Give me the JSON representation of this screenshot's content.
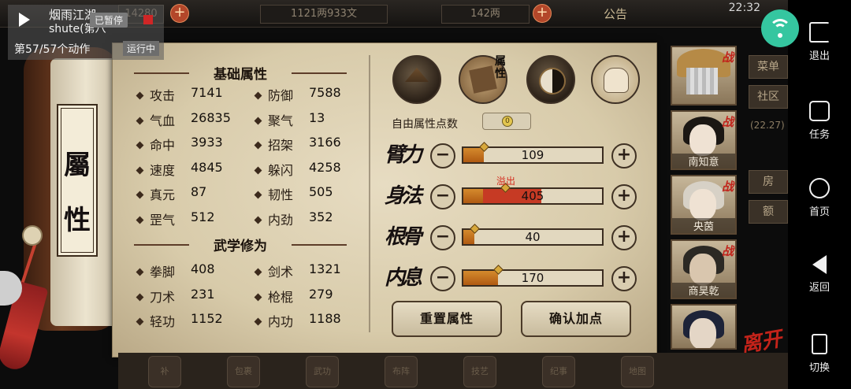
{
  "recorder": {
    "title": "烟雨江湖",
    "subtitle": "shute(第八",
    "paused": "已暂停",
    "action_count": "第57/57个动作",
    "running": "运行中"
  },
  "topbar": {
    "silver": "1121两933文",
    "gold": "142两",
    "notice": "公告",
    "time": "22:32",
    "left_value": "14280"
  },
  "scroll": {
    "chars": [
      "屬",
      "性"
    ]
  },
  "basic": {
    "title": "基础属性",
    "stats": [
      {
        "label": "攻击",
        "value": "7141"
      },
      {
        "label": "防御",
        "value": "7588"
      },
      {
        "label": "气血",
        "value": "26835"
      },
      {
        "label": "聚气",
        "value": "13"
      },
      {
        "label": "命中",
        "value": "3933"
      },
      {
        "label": "招架",
        "value": "3166"
      },
      {
        "label": "速度",
        "value": "4845"
      },
      {
        "label": "躲闪",
        "value": "4258"
      },
      {
        "label": "真元",
        "value": "87"
      },
      {
        "label": "韧性",
        "value": "505"
      },
      {
        "label": "罡气",
        "value": "512"
      },
      {
        "label": "内劲",
        "value": "352"
      }
    ]
  },
  "martial": {
    "title": "武学修为",
    "stats": [
      {
        "label": "拳脚",
        "value": "408"
      },
      {
        "label": "剑术",
        "value": "1321"
      },
      {
        "label": "刀术",
        "value": "231"
      },
      {
        "label": "枪棍",
        "value": "279"
      },
      {
        "label": "轻功",
        "value": "1152"
      },
      {
        "label": "内功",
        "value": "1188"
      }
    ]
  },
  "tabs": {
    "attr_tab_label": "属性",
    "icons": [
      "hat-figure-icon",
      "attribute-book-icon",
      "yin-yang-icon",
      "body-meridian-icon"
    ]
  },
  "free_points": {
    "label": "自由属性点数",
    "value": "0"
  },
  "attributes": [
    {
      "name": "臂力",
      "value": "109",
      "fill": 0.15,
      "overflow": false
    },
    {
      "name": "身法",
      "value": "405",
      "fill": 0.56,
      "overflow": true,
      "overflow_label": "溢出"
    },
    {
      "name": "根骨",
      "value": "40",
      "fill": 0.08,
      "overflow": false
    },
    {
      "name": "内息",
      "value": "170",
      "fill": 0.25,
      "overflow": false
    }
  ],
  "buttons": {
    "reset": "重置属性",
    "confirm": "确认加点"
  },
  "characters": [
    {
      "name": "",
      "battle": "战",
      "blurred": true
    },
    {
      "name": "南知意",
      "battle": "战"
    },
    {
      "name": "央茵",
      "battle": "战"
    },
    {
      "name": "商昊乾",
      "battle": "战"
    },
    {
      "name": "",
      "battle": ""
    }
  ],
  "leave_label": "离开",
  "side_tabs": [
    "菜单",
    "社区",
    "房",
    "额"
  ],
  "side_date": "(22.27)",
  "bottom_icons": [
    "补",
    "包裹",
    "武功",
    "布阵",
    "技艺",
    "纪事",
    "地图"
  ],
  "nav": {
    "exit": "退出",
    "task": "任务",
    "home": "首页",
    "back": "返回",
    "switch": "切换"
  },
  "colors": {
    "bar_fill": "#c26b1a",
    "overflow": "#c63a24",
    "accent_red": "#c1231b",
    "wifi": "#35c6a0"
  }
}
